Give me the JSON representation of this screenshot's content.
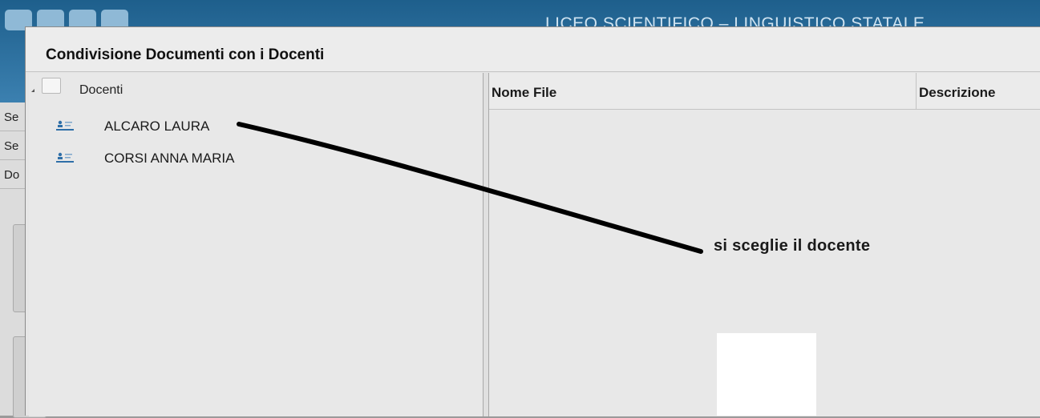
{
  "background_app": {
    "school_name": "LICEO SCIENTIFICO – LINGUISTICO STATALE",
    "left_rows": [
      "Se",
      "Se",
      "Do"
    ]
  },
  "dialog": {
    "title": "Condivisione Documenti con i Docenti"
  },
  "tree": {
    "root_label": "Docenti",
    "root_icon": "folder-icon",
    "items": [
      {
        "label": "ALCARO LAURA",
        "icon": "id-card-icon"
      },
      {
        "label": "CORSI ANNA MARIA",
        "icon": "id-card-icon"
      }
    ]
  },
  "file_table": {
    "columns": [
      "Nome File",
      "Descrizione"
    ],
    "rows": []
  },
  "annotation": {
    "text": "si sceglie il docente"
  },
  "colors": {
    "header_blue": "#1e5f8c",
    "icon_blue": "#2f6fa8"
  }
}
